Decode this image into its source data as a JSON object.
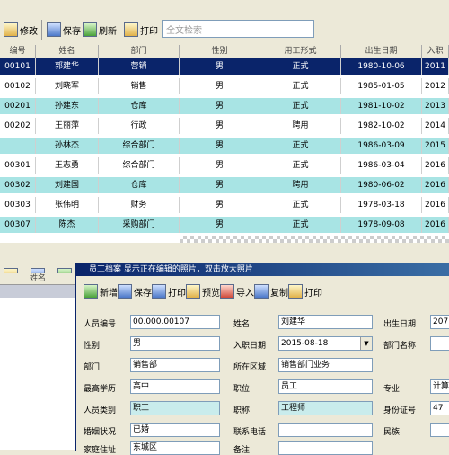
{
  "toolbar": {
    "items": [
      {
        "label": "修改",
        "icon": "edit-icon"
      },
      {
        "label": "保存",
        "icon": "save-icon"
      },
      {
        "label": "刷新",
        "icon": "refresh-icon"
      },
      {
        "label": "打印",
        "icon": "print-icon"
      }
    ],
    "search_placeholder": "全文检索"
  },
  "grid": {
    "headers": [
      "编号",
      "姓名",
      "部门",
      "性别",
      "用工形式",
      "出生日期",
      "入职"
    ],
    "rows": [
      [
        "00101",
        "郭建华",
        "营销",
        "男",
        "正式",
        "1980-10-06",
        "2011"
      ],
      [
        "00102",
        "刘晓军",
        "销售",
        "男",
        "正式",
        "1985-01-05",
        "2012"
      ],
      [
        "00201",
        "孙建东",
        "仓库",
        "男",
        "正式",
        "1981-10-02",
        "2013"
      ],
      [
        "00202",
        "王丽萍",
        "行政",
        "男",
        "聘用",
        "1982-10-02",
        "2014"
      ],
      [
        "",
        "孙林杰",
        "综合部门",
        "男",
        "正式",
        "1986-03-09",
        "2015"
      ],
      [
        "00301",
        "王志勇",
        "综合部门",
        "男",
        "正式",
        "1986-03-04",
        "2016"
      ],
      [
        "00302",
        "刘建国",
        "仓库",
        "男",
        "聘用",
        "1980-06-02",
        "2016"
      ],
      [
        "00303",
        "张伟明",
        "财务",
        "男",
        "正式",
        "1978-03-18",
        "2016"
      ],
      [
        "00307",
        "陈杰",
        "采购部门",
        "男",
        "正式",
        "1978-09-08",
        "2016"
      ]
    ]
  },
  "lower": {
    "left_header": "姓名"
  },
  "dialog": {
    "title": "员工档案 显示正在编辑的照片，双击放大照片",
    "tools": [
      {
        "label": "新增",
        "icon": "add-icon"
      },
      {
        "label": "保存",
        "icon": "save-icon"
      },
      {
        "label": "打印",
        "icon": "print-icon"
      },
      {
        "label": "预览",
        "icon": "preview-icon"
      },
      {
        "label": "导入",
        "icon": "import-icon"
      },
      {
        "label": "复制",
        "icon": "copy-icon"
      },
      {
        "label": "打印",
        "icon": "print-icon"
      }
    ],
    "fields": {
      "emp_no_label": "人员编号",
      "emp_no": "00.000.00107",
      "name_label": "姓名",
      "name": "刘建华",
      "birth_label": "出生日期",
      "birth": "207",
      "gender_label": "性别",
      "gender": "男",
      "join_label": "入职日期",
      "join": "2015-08-18",
      "dept2_label": "部门名称",
      "dept_label": "部门",
      "dept": "销售部",
      "workplace_label": "所在区域",
      "workplace": "销售部门业务",
      "edu_label": "最高学历",
      "edu": "高中",
      "major_label": "专业",
      "major": "计算",
      "post_label": "职位",
      "post": "员工",
      "type_label": "人员类别",
      "type": "职工",
      "title_label": "职称",
      "title": "工程师",
      "id_label": "身份证号",
      "id": "47",
      "marry_label": "婚姻状况",
      "marry": "已婚",
      "nation_label": "民族",
      "phone_label": "联系电话",
      "address_label": "家庭住址",
      "address": "东城区",
      "remark_label": "备注"
    }
  },
  "colors": {
    "selected_row": "#0a246a",
    "alt_row": "#a8e4e4",
    "title_start": "#0a246a",
    "title_end": "#3a6ea5"
  }
}
